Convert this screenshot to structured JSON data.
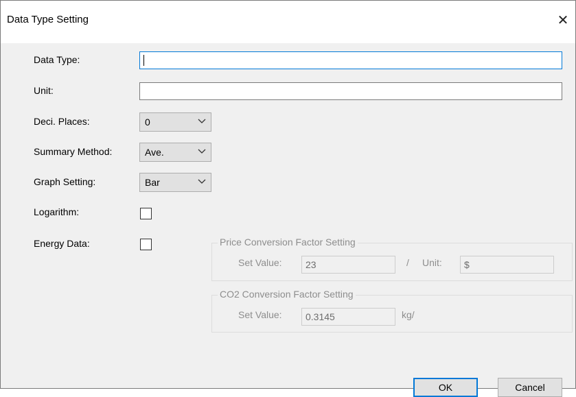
{
  "window": {
    "title": "Data Type Setting",
    "close_glyph": "✕"
  },
  "form": {
    "data_type_label": "Data Type:",
    "data_type_value": "",
    "unit_label": "Unit:",
    "unit_value": "",
    "deci_places_label": "Deci. Places:",
    "deci_places_value": "0",
    "summary_method_label": "Summary Method:",
    "summary_method_value": "Ave.",
    "graph_setting_label": "Graph Setting:",
    "graph_setting_value": "Bar",
    "logarithm_label": "Logarithm:",
    "logarithm_checked": false,
    "energy_data_label": "Energy Data:",
    "energy_data_checked": false
  },
  "price_group": {
    "title": "Price Conversion Factor Setting",
    "set_value_label": "Set Value:",
    "set_value": "23",
    "slash": "/",
    "unit_label": "Unit:",
    "unit_value": "$"
  },
  "co2_group": {
    "title": "CO2 Conversion Factor Setting",
    "set_value_label": "Set Value:",
    "set_value": "0.3145",
    "unit_suffix": "kg/"
  },
  "buttons": {
    "ok": "OK",
    "cancel": "Cancel"
  },
  "colors": {
    "accent": "#0078d7",
    "dialog_bg": "#f0f0f0",
    "disabled_text": "#8d8d8d"
  }
}
